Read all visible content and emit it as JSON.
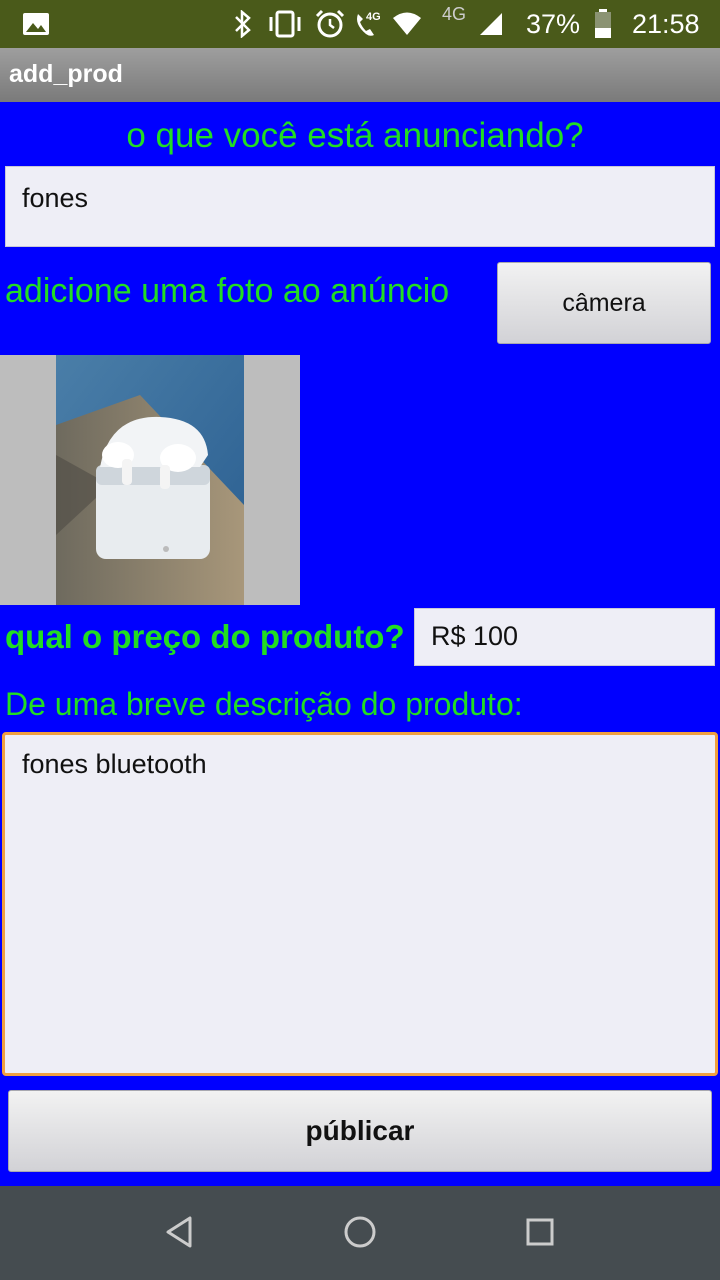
{
  "status_bar": {
    "battery_percent": "37%",
    "time": "21:58",
    "network_primary": "4G",
    "network_secondary": "4G"
  },
  "app": {
    "title": "add_prod"
  },
  "form": {
    "question_label": "o que você está anunciando?",
    "product_name_value": "fones",
    "photo_label": "adicione uma foto ao anúncio",
    "camera_button": "câmera",
    "price_label": "qual o preço do produto?",
    "price_value": "R$ 100",
    "description_label": "De uma breve descrição do produto:",
    "description_value": "fones bluetooth",
    "publish_button": "públicar"
  },
  "colors": {
    "background": "#0000ff",
    "label_green": "#22dd22",
    "focus_orange": "#f0a040",
    "status_bar": "#4a5a1a"
  }
}
